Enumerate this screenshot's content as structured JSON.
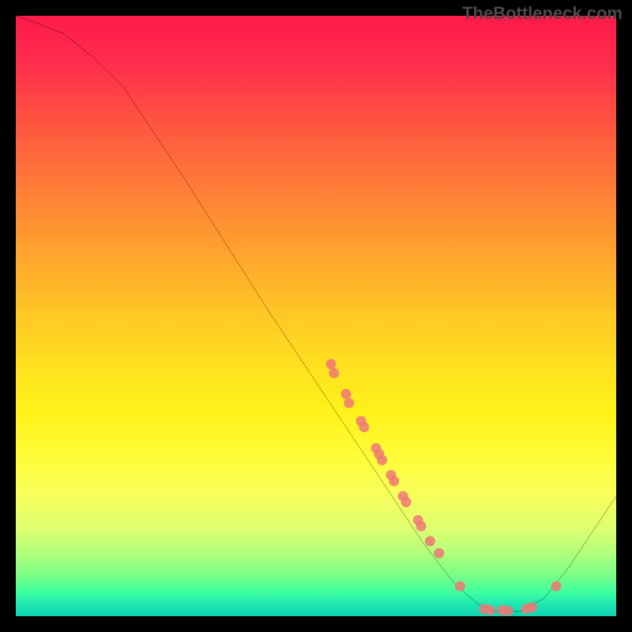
{
  "watermark": "TheBottleneck.com",
  "chart_data": {
    "type": "line",
    "title": "",
    "xlabel": "",
    "ylabel": "",
    "xlim": [
      0,
      100
    ],
    "ylim": [
      0,
      100
    ],
    "curve": [
      {
        "x": 0,
        "y": 100
      },
      {
        "x": 3,
        "y": 99
      },
      {
        "x": 8,
        "y": 97
      },
      {
        "x": 13,
        "y": 93
      },
      {
        "x": 18,
        "y": 88
      },
      {
        "x": 22,
        "y": 82
      },
      {
        "x": 28,
        "y": 73
      },
      {
        "x": 35,
        "y": 62
      },
      {
        "x": 42,
        "y": 51
      },
      {
        "x": 50,
        "y": 39
      },
      {
        "x": 56,
        "y": 30
      },
      {
        "x": 62,
        "y": 21
      },
      {
        "x": 68,
        "y": 12
      },
      {
        "x": 73,
        "y": 5.5
      },
      {
        "x": 77,
        "y": 2
      },
      {
        "x": 80,
        "y": 0.8
      },
      {
        "x": 84,
        "y": 0.8
      },
      {
        "x": 88,
        "y": 3
      },
      {
        "x": 92,
        "y": 8
      },
      {
        "x": 96,
        "y": 14
      },
      {
        "x": 100,
        "y": 20
      }
    ],
    "points": [
      {
        "x": 52.5,
        "y": 42
      },
      {
        "x": 53,
        "y": 40.5
      },
      {
        "x": 55,
        "y": 37
      },
      {
        "x": 55.5,
        "y": 35.5
      },
      {
        "x": 57.5,
        "y": 32.5
      },
      {
        "x": 58,
        "y": 31.5
      },
      {
        "x": 60,
        "y": 28
      },
      {
        "x": 60.5,
        "y": 27
      },
      {
        "x": 61,
        "y": 26
      },
      {
        "x": 62.5,
        "y": 23.5
      },
      {
        "x": 63,
        "y": 22.5
      },
      {
        "x": 64.5,
        "y": 20
      },
      {
        "x": 65,
        "y": 19
      },
      {
        "x": 67,
        "y": 16
      },
      {
        "x": 67.5,
        "y": 15
      },
      {
        "x": 69,
        "y": 12.5
      },
      {
        "x": 70.5,
        "y": 10.5
      },
      {
        "x": 74,
        "y": 5
      },
      {
        "x": 78,
        "y": 1.2
      },
      {
        "x": 79,
        "y": 1
      },
      {
        "x": 81,
        "y": 1
      },
      {
        "x": 82,
        "y": 0.9
      },
      {
        "x": 85,
        "y": 1.2
      },
      {
        "x": 86,
        "y": 1.5
      },
      {
        "x": 90,
        "y": 5
      }
    ],
    "point_color": "#f07875",
    "curve_color": "#000000"
  }
}
